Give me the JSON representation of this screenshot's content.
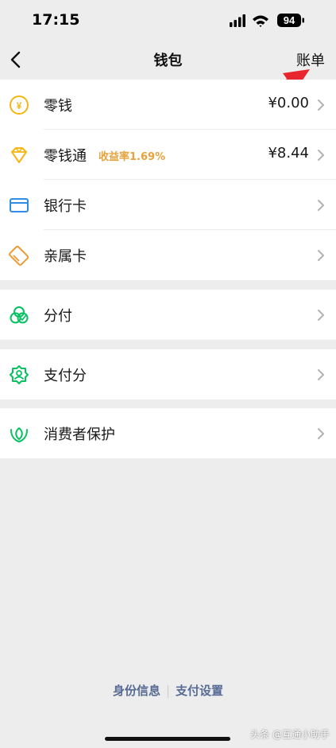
{
  "status_bar": {
    "time": "17:15",
    "battery": "94"
  },
  "nav": {
    "title": "钱包",
    "action": "账单"
  },
  "groups": [
    {
      "items": [
        {
          "label": "零钱",
          "value": "¥0.00",
          "icon": "yuan-coin-icon"
        },
        {
          "label": "零钱通",
          "badge": "收益率1.69%",
          "value": "¥8.44",
          "icon": "diamond-icon"
        },
        {
          "label": "银行卡",
          "icon": "bank-card-icon"
        },
        {
          "label": "亲属卡",
          "icon": "family-card-icon"
        }
      ]
    },
    {
      "items": [
        {
          "label": "分付",
          "icon": "fenfu-icon"
        }
      ]
    },
    {
      "items": [
        {
          "label": "支付分",
          "icon": "pay-score-icon"
        }
      ]
    },
    {
      "items": [
        {
          "label": "消费者保护",
          "icon": "consumer-protection-icon"
        }
      ]
    }
  ],
  "footer": {
    "identity": "身份信息",
    "pay_settings": "支付设置"
  },
  "watermark": "头条 @互通小助手",
  "colors": {
    "background": "#ededed",
    "accent_green": "#07c160",
    "yield_orange": "#e6a23c",
    "link_blue": "#576b95",
    "arrow_red": "#e8262e"
  }
}
